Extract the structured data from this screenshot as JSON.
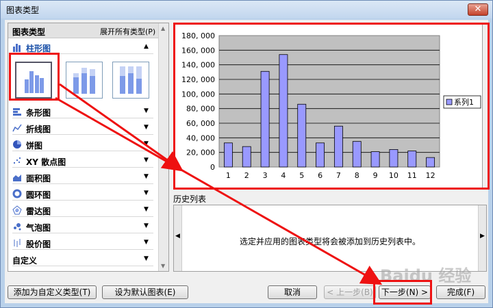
{
  "window": {
    "title": "图表类型",
    "close_glyph": "✕"
  },
  "left_panel": {
    "header_title": "图表类型",
    "expand_all": "展开所有类型(P)",
    "categories": [
      {
        "label": "柱形图",
        "icon": "bar-chart-icon",
        "arrow": "▲"
      },
      {
        "label": "条形图",
        "icon": "horizontal-bar-icon",
        "arrow": "▼"
      },
      {
        "label": "折线图",
        "icon": "line-chart-icon",
        "arrow": "▼"
      },
      {
        "label": "饼图",
        "icon": "pie-chart-icon",
        "arrow": "▼"
      },
      {
        "label": "XY 散点图",
        "icon": "scatter-icon",
        "arrow": "▼"
      },
      {
        "label": "面积图",
        "icon": "area-chart-icon",
        "arrow": "▼"
      },
      {
        "label": "圆环图",
        "icon": "doughnut-icon",
        "arrow": "▼"
      },
      {
        "label": "雷达图",
        "icon": "radar-icon",
        "arrow": "▼"
      },
      {
        "label": "气泡图",
        "icon": "bubble-icon",
        "arrow": "▼"
      },
      {
        "label": "股价图",
        "icon": "stock-icon",
        "arrow": "▼"
      },
      {
        "label": "自定义",
        "icon": "",
        "arrow": "▼"
      }
    ],
    "subtypes": [
      "clustered-column",
      "stacked-column",
      "percent-stacked-column"
    ]
  },
  "chart_data": {
    "type": "bar",
    "categories": [
      "1",
      "2",
      "3",
      "4",
      "5",
      "6",
      "7",
      "8",
      "9",
      "10",
      "11",
      "12"
    ],
    "series": [
      {
        "name": "系列1",
        "values": [
          33000,
          28000,
          131000,
          154000,
          86000,
          33000,
          56000,
          35000,
          21000,
          24000,
          22000,
          13000
        ]
      }
    ],
    "yticks": [
      "0",
      "20, 000",
      "40, 000",
      "60, 000",
      "80, 000",
      "100, 000",
      "120, 000",
      "140, 000",
      "160, 000",
      "180, 000"
    ],
    "ylim": [
      0,
      180000
    ],
    "grid": true,
    "legend": "right",
    "plot_bg": "#c0c0c0",
    "bar_color": "#9999ff"
  },
  "history": {
    "label": "历史列表",
    "message": "选定并应用的图表类型将会被添加到历史列表中。",
    "left_arrow": "◀",
    "right_arrow": "▶"
  },
  "buttons": {
    "add_custom": "添加为自定义类型(T)",
    "set_default": "设为默认图表(E)",
    "cancel": "取消",
    "back": "< 上一步(B)",
    "next": "下一步(N) >",
    "finish": "完成(F)"
  },
  "watermark": "Baidu 经验",
  "colors": {
    "highlight": "#ee1111",
    "accent": "#1a50a8"
  }
}
